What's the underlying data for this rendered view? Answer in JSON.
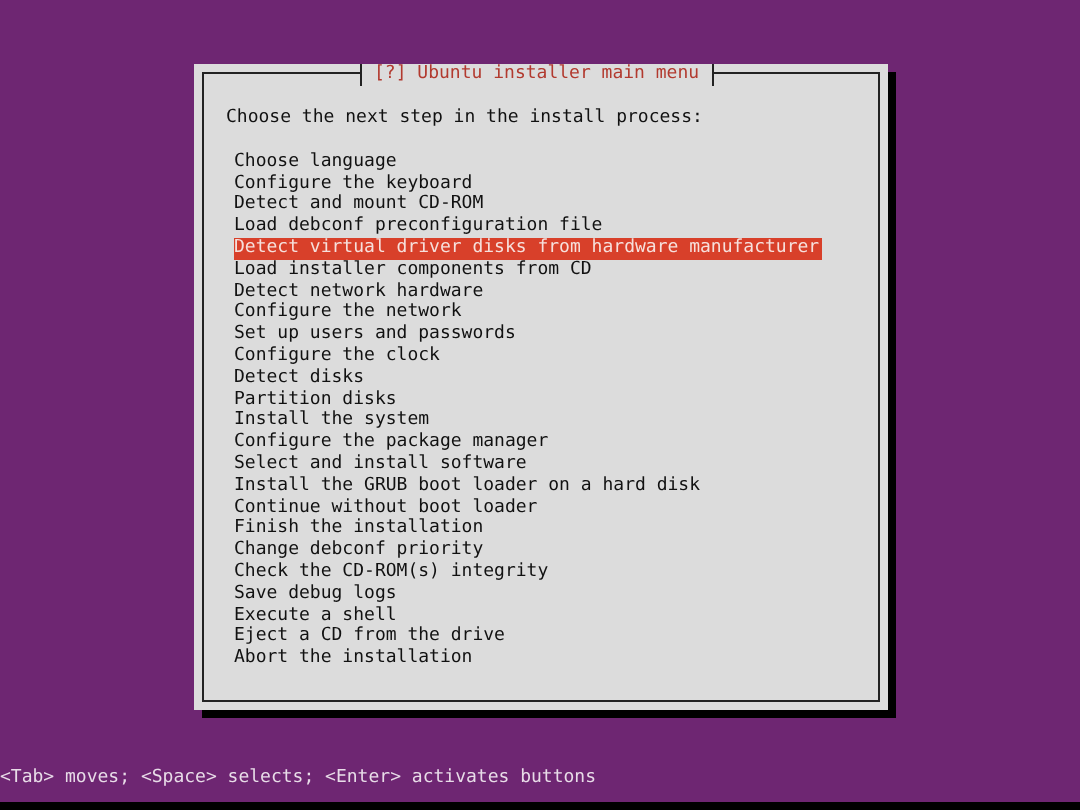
{
  "dialog": {
    "title": "[?] Ubuntu installer main menu",
    "prompt": "Choose the next step in the install process:",
    "items": [
      {
        "label": "Choose language",
        "selected": false
      },
      {
        "label": "Configure the keyboard",
        "selected": false
      },
      {
        "label": "Detect and mount CD-ROM",
        "selected": false
      },
      {
        "label": "Load debconf preconfiguration file",
        "selected": false
      },
      {
        "label": "Detect virtual driver disks from hardware manufacturer",
        "selected": true
      },
      {
        "label": "Load installer components from CD",
        "selected": false
      },
      {
        "label": "Detect network hardware",
        "selected": false
      },
      {
        "label": "Configure the network",
        "selected": false
      },
      {
        "label": "Set up users and passwords",
        "selected": false
      },
      {
        "label": "Configure the clock",
        "selected": false
      },
      {
        "label": "Detect disks",
        "selected": false
      },
      {
        "label": "Partition disks",
        "selected": false
      },
      {
        "label": "Install the system",
        "selected": false
      },
      {
        "label": "Configure the package manager",
        "selected": false
      },
      {
        "label": "Select and install software",
        "selected": false
      },
      {
        "label": "Install the GRUB boot loader on a hard disk",
        "selected": false
      },
      {
        "label": "Continue without boot loader",
        "selected": false
      },
      {
        "label": "Finish the installation",
        "selected": false
      },
      {
        "label": "Change debconf priority",
        "selected": false
      },
      {
        "label": "Check the CD-ROM(s) integrity",
        "selected": false
      },
      {
        "label": "Save debug logs",
        "selected": false
      },
      {
        "label": "Execute a shell",
        "selected": false
      },
      {
        "label": "Eject a CD from the drive",
        "selected": false
      },
      {
        "label": "Abort the installation",
        "selected": false
      }
    ]
  },
  "status_bar": "<Tab> moves; <Space> selects; <Enter> activates buttons"
}
